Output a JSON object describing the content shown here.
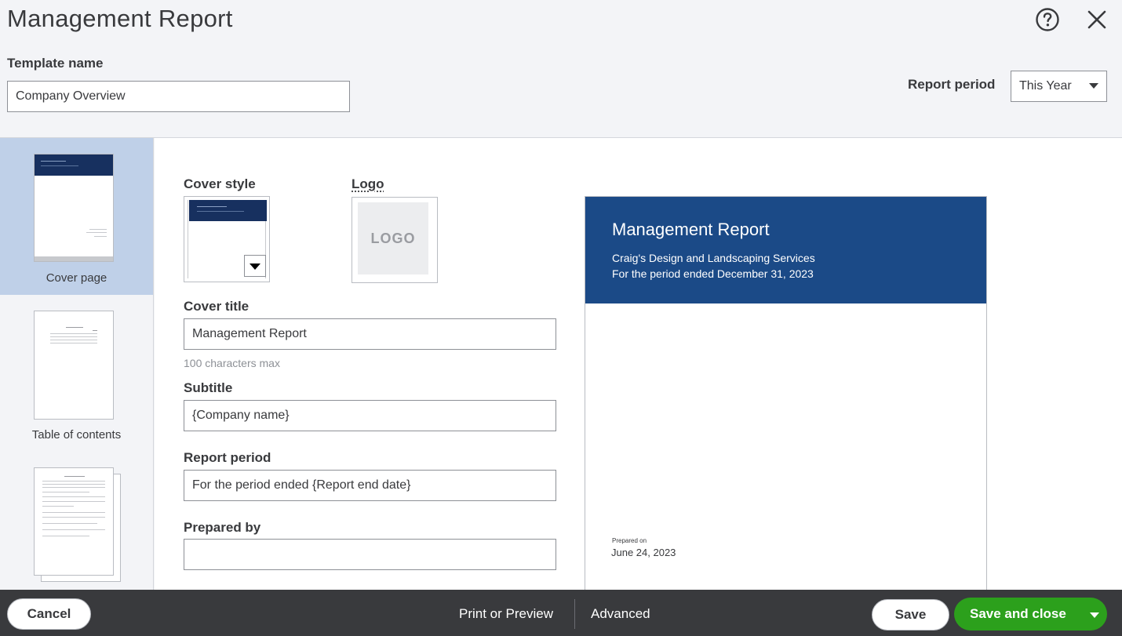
{
  "header": {
    "title": "Management Report",
    "help_icon": "help-circle-icon",
    "close_icon": "close-icon",
    "template_name_label": "Template name",
    "template_name_value": "Company Overview",
    "report_period_label": "Report period",
    "report_period_value": "This Year"
  },
  "sidebar": {
    "items": [
      {
        "label": "Cover page",
        "active": true
      },
      {
        "label": "Table of contents",
        "active": false
      },
      {
        "label": "",
        "active": false
      }
    ]
  },
  "form": {
    "cover_style_label": "Cover style",
    "logo_label": "Logo",
    "logo_placeholder": "LOGO",
    "cover_title_label": "Cover title",
    "cover_title_value": "Management Report",
    "cover_title_hint": "100 characters max",
    "subtitle_label": "Subtitle",
    "subtitle_value": "{Company name}",
    "report_period_label": "Report period",
    "report_period_value": "For the period ended {Report end date}",
    "prepared_by_label": "Prepared by",
    "prepared_by_value": ""
  },
  "preview": {
    "title": "Management Report",
    "subtitle": "Craig's Design and Landscaping Services",
    "period": "For the period ended December 31, 2023",
    "prepared_on_label": "Prepared on",
    "prepared_on_date": "June 24, 2023",
    "band_color": "#1b4a87"
  },
  "footer": {
    "cancel_label": "Cancel",
    "print_label": "Print or Preview",
    "advanced_label": "Advanced",
    "save_label": "Save",
    "save_close_label": "Save and close"
  },
  "colors": {
    "accent_green": "#2ca01c",
    "footer_bg": "#393a3d",
    "sidebar_active": "#bfd0e8",
    "cover_navy": "#17305f"
  }
}
